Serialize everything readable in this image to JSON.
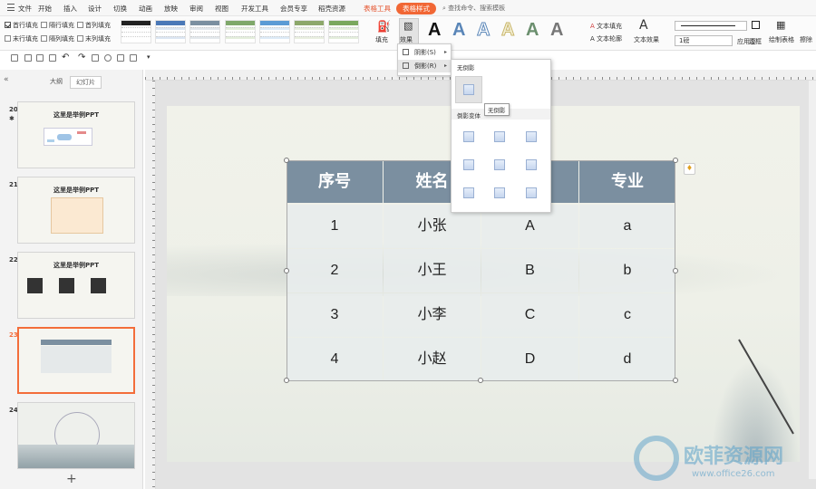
{
  "menu": {
    "items": [
      "文件",
      "开始",
      "插入",
      "设计",
      "切换",
      "动画",
      "放映",
      "审阅",
      "视图",
      "开发工具",
      "会员专享",
      "稻壳资源"
    ],
    "context_tab": "表格工具",
    "active_tab": "表格样式",
    "search": "查找命令、搜索模板"
  },
  "ribbon": {
    "checkboxes": [
      {
        "label": "首行填充",
        "checked": true
      },
      {
        "label": "隔行填充",
        "checked": false
      },
      {
        "label": "首列填充",
        "checked": false
      },
      {
        "label": "末行填充",
        "checked": false
      },
      {
        "label": "隔列填充",
        "checked": false
      },
      {
        "label": "末列填充",
        "checked": false
      }
    ],
    "fill_label": "填充",
    "effect_label": "效果",
    "text_fill": "文本填充",
    "text_outline": "文本轮廓",
    "text_effect": "文本效果",
    "line_width": "1磅",
    "apply_to": "应用至",
    "border": "边框",
    "draw_table": "绘制表格",
    "erase": "擦除",
    "wordart_letter": "A"
  },
  "panel": {
    "tab_outline": "大纲",
    "tab_slides": "幻灯片",
    "slides": [
      {
        "num": "20",
        "title": "这里是举例PPT"
      },
      {
        "num": "21",
        "title": "这里是举例PPT"
      },
      {
        "num": "22",
        "title": "这里是举例PPT"
      },
      {
        "num": "23",
        "title": ""
      },
      {
        "num": "24",
        "title": ""
      }
    ],
    "add": "+"
  },
  "table": {
    "headers": [
      "序号",
      "姓名",
      "",
      "专业"
    ],
    "rows": [
      [
        "1",
        "小张",
        "A",
        "a"
      ],
      [
        "2",
        "小王",
        "B",
        "b"
      ],
      [
        "3",
        "小李",
        "C",
        "c"
      ],
      [
        "4",
        "小赵",
        "D",
        "d"
      ]
    ],
    "header_color": "#7b8fa0"
  },
  "effects_menu": {
    "shadow": "阴影(S)",
    "reflection": "倒影(R)",
    "no_reflection": "无倒影",
    "variants": "倒影变体",
    "tooltip": "无倒影"
  },
  "watermark": {
    "text": "欧菲资源网",
    "url": "www.office26.com"
  }
}
